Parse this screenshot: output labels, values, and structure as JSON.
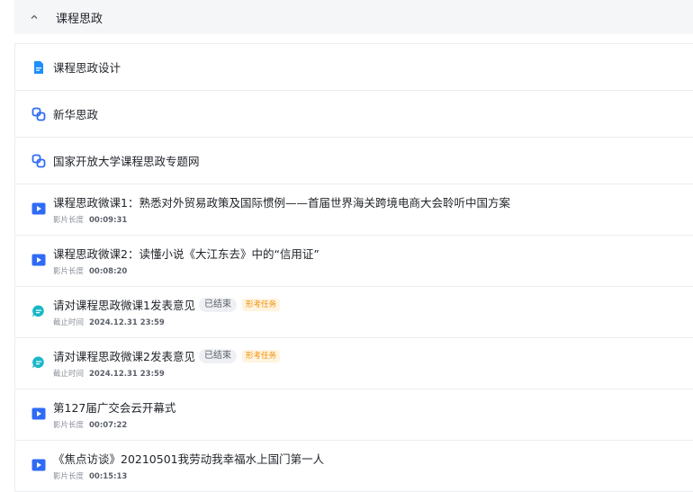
{
  "section": {
    "title": "课程思政",
    "collapse_icon": "chevron-up-icon"
  },
  "colors": {
    "blue": "#2f6bf6",
    "teal": "#19b8c8",
    "orange": "#f08c00"
  },
  "items": [
    {
      "type": "document",
      "icon": "document-icon",
      "title": "课程思政设计"
    },
    {
      "type": "link",
      "icon": "link-icon",
      "title": "新华思政"
    },
    {
      "type": "link",
      "icon": "link-icon",
      "title": "国家开放大学课程思政专题网"
    },
    {
      "type": "video",
      "icon": "video-play-icon",
      "title": "课程思政微课1：熟悉对外贸易政策及国际惯例——首届世界海关跨境电商大会聆听中国方案",
      "meta_label": "影片长度",
      "meta_value": "00:09:31"
    },
    {
      "type": "video",
      "icon": "video-play-icon",
      "title": "课程思政微课2：读懂小说《大江东去》中的“信用证”",
      "meta_label": "影片长度",
      "meta_value": "00:08:20"
    },
    {
      "type": "discussion",
      "icon": "discussion-icon",
      "title": "请对课程思政微课1发表意见",
      "status": "已结束",
      "tag": "形考任务",
      "meta_label": "截止时间",
      "meta_value": "2024.12.31 23:59"
    },
    {
      "type": "discussion",
      "icon": "discussion-icon",
      "title": "请对课程思政微课2发表意见",
      "status": "已结束",
      "tag": "形考任务",
      "meta_label": "截止时间",
      "meta_value": "2024.12.31 23:59"
    },
    {
      "type": "video",
      "icon": "video-play-icon",
      "title": "第127届广交会云开幕式",
      "meta_label": "影片长度",
      "meta_value": "00:07:22"
    },
    {
      "type": "video",
      "icon": "video-play-icon",
      "title": "《焦点访谈》20210501我劳动我幸福水上国门第一人",
      "meta_label": "影片长度",
      "meta_value": "00:15:13"
    }
  ]
}
